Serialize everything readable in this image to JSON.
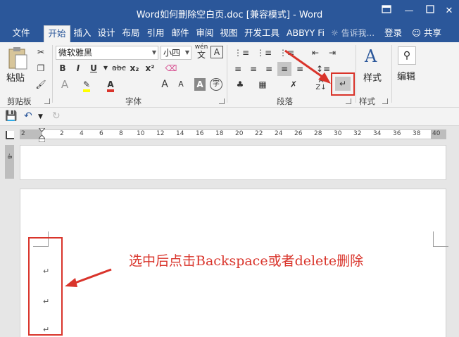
{
  "window": {
    "title": "Word如何删除空白页.doc [兼容模式] - Word",
    "help_icon": "help-window-icon",
    "buttons": [
      "minimize",
      "restore",
      "close"
    ]
  },
  "tabs": [
    {
      "label": "文件"
    },
    {
      "label": "开始",
      "active": true
    },
    {
      "label": "插入"
    },
    {
      "label": "设计"
    },
    {
      "label": "布局"
    },
    {
      "label": "引用"
    },
    {
      "label": "邮件"
    },
    {
      "label": "审阅"
    },
    {
      "label": "视图"
    },
    {
      "label": "开发工具"
    },
    {
      "label": "ABBYY Fi"
    }
  ],
  "tell_me": "告诉我...",
  "login": "登录",
  "share": "共享",
  "ribbon": {
    "clipboard": {
      "label": "剪贴板",
      "paste": "粘贴"
    },
    "font": {
      "label": "字体",
      "font_name": "微软雅黑",
      "font_size": "小四",
      "phonetic": "wén",
      "phonetic_char": "文",
      "border_char": "A",
      "bold": "B",
      "italic": "I",
      "underline": "U",
      "strike": "abc",
      "subscript": "x₂",
      "superscript": "x²",
      "color_a": "A",
      "grow": "A",
      "shrink": "A",
      "char_shading": "A",
      "enclose": "字"
    },
    "paragraph": {
      "label": "段落"
    },
    "styles": {
      "label": "样式",
      "button": "样式"
    },
    "editing": {
      "button": "编辑"
    }
  },
  "ruler_ticks": [
    "2",
    "2",
    "4",
    "6",
    "8",
    "10",
    "12",
    "14",
    "16",
    "18",
    "20",
    "22",
    "24",
    "26",
    "28",
    "30",
    "32",
    "34",
    "36",
    "38",
    "40"
  ],
  "vruler_label": "-8",
  "annotation": "选中后点击Backspace或者delete删除",
  "colors": {
    "title_bar": "#2b579a",
    "highlight_red": "#d9342b",
    "ribbon_bg": "#f3f3f3"
  }
}
